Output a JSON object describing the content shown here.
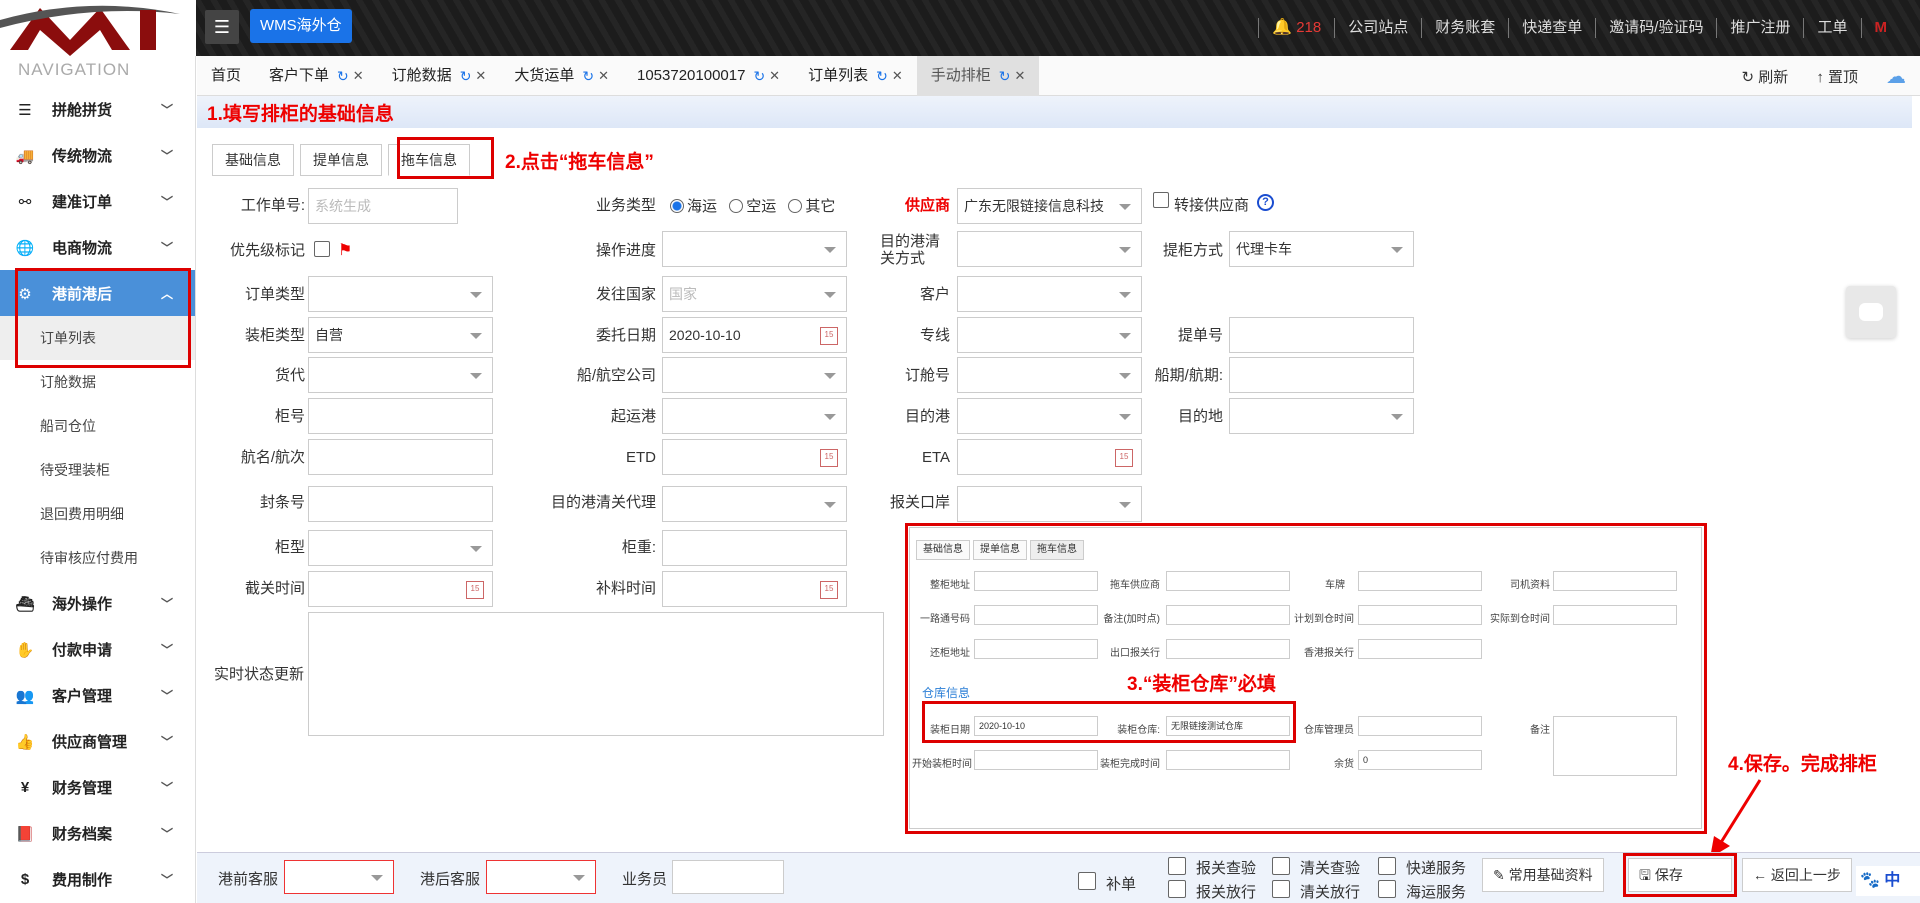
{
  "header": {
    "menu_icon": "hamburger-icon",
    "app_button": "WMS海外仓",
    "notif_count": "218",
    "links": [
      "公司站点",
      "财务账套",
      "快递查单",
      "邀请码/验证码",
      "推广注册",
      "工单"
    ]
  },
  "sidebar": {
    "title": "NAVIGATION",
    "items": [
      {
        "label": "拼舱拼货",
        "icon": "layers-icon"
      },
      {
        "label": "传统物流",
        "icon": "truck-icon"
      },
      {
        "label": "建准订单",
        "icon": "route-icon"
      },
      {
        "label": "电商物流",
        "icon": "globe-icon"
      },
      {
        "label": "港前港后",
        "icon": "ship-icon"
      },
      {
        "label": "海外操作",
        "icon": "ship-icon"
      },
      {
        "label": "付款申请",
        "icon": "hand-money-icon"
      },
      {
        "label": "客户管理",
        "icon": "users-icon"
      },
      {
        "label": "供应商管理",
        "icon": "thumbs-up-icon"
      },
      {
        "label": "财务管理",
        "icon": "yen-icon"
      },
      {
        "label": "财务档案",
        "icon": "book-icon"
      },
      {
        "label": "费用制作",
        "icon": "dollar-icon"
      }
    ],
    "sub_items": [
      "订单列表",
      "订舱数据",
      "船司仓位",
      "待受理装柜",
      "退回费用明细",
      "待审核应付费用"
    ]
  },
  "tabs": [
    {
      "label": "首页"
    },
    {
      "label": "客户下单"
    },
    {
      "label": "订舱数据"
    },
    {
      "label": "大货运单"
    },
    {
      "label": "1053720100017"
    },
    {
      "label": "订单列表"
    },
    {
      "label": "手动排柜"
    }
  ],
  "tab_actions": {
    "refresh": "刷新",
    "top": "置顶"
  },
  "annotations": {
    "a1": "1.填写排柜的基础信息",
    "a2": "2.点击“拖车信息”",
    "a3": "3.“装柜仓库”必填",
    "a4": "4.保存。完成排柜"
  },
  "form_tabs": [
    "基础信息",
    "提单信息",
    "拖车信息"
  ],
  "form": {
    "work_no_label": "工作单号:",
    "work_no_ph": "系统生成",
    "biz_type_label": "业务类型",
    "biz_opts": [
      "海运",
      "空运",
      "其它"
    ],
    "supplier_label": "供应商",
    "supplier_value": "广东无限链接信息科技",
    "transfer_label": "转接供应商",
    "priority_label": "优先级标记",
    "progress_label": "操作进度",
    "dest_clear_label": "目的港清关方式",
    "bl_mode_label": "提柜方式",
    "bl_mode_value": "代理卡车",
    "order_type_label": "订单类型",
    "dest_country_label": "发往国家",
    "dest_country_ph": "国家",
    "customer_label": "客户",
    "load_type_label": "装柜类型",
    "load_type_value": "自营",
    "entrust_date_label": "委托日期",
    "entrust_date_value": "2020-10-10",
    "line_label": "专线",
    "bl_no_label": "提单号",
    "forwarder_label": "货代",
    "carrier_label": "船/航空公司",
    "booking_label": "订舱号",
    "voyage_date_label": "船期/航期:",
    "container_no_label": "柜号",
    "pol_label": "起运港",
    "pod_label": "目的港",
    "dest_label": "目的地",
    "vessel_label": "航名/航次",
    "etd_label": "ETD",
    "eta_label": "ETA",
    "seal_label": "封条号",
    "dest_agent_label": "目的港清关代理",
    "customs_port_label": "报关口岸",
    "container_type_label": "柜型",
    "weight_label": "柜重:",
    "cutoff_label": "截关时间",
    "supply_label": "补料时间",
    "status_label": "实时状态更新"
  },
  "inset": {
    "tabs": [
      "基础信息",
      "提单信息",
      "拖车信息"
    ],
    "labels": {
      "pickup_addr": "整柜地址",
      "truck_supplier": "拖车供应商",
      "plate": "车牌",
      "driver": "司机资料",
      "one_stop": "一路通号码",
      "remark_time": "备注(加时点)",
      "plan_arrive": "计划到仓时间",
      "actual_arrive": "实际到仓时间",
      "return_addr": "还柜地址",
      "export_agent": "出口报关行",
      "hk_agent": "香港报关行",
      "warehouse_info": "仓库信息",
      "load_date": "装柜日期",
      "load_wh": "装柜仓库:",
      "wh_manager": "仓库管理员",
      "remark": "备注",
      "start_time": "开始装柜时间",
      "end_time": "装柜完成时间",
      "remaining": "余货"
    },
    "load_date_value": "2020-10-10",
    "load_wh_value": "无限链接测试仓库",
    "remaining_value": "0"
  },
  "bottom": {
    "pre_cs": "港前客服",
    "post_cs": "港后客服",
    "salesman": "业务员",
    "supplement": "补单",
    "checks": [
      "报关查验",
      "报关放行",
      "清关查验",
      "清关放行",
      "快递服务",
      "海运服务"
    ],
    "common_btn": "常用基础资料",
    "save_btn": "保存",
    "back_btn": "返回上一步",
    "lang": "中"
  }
}
